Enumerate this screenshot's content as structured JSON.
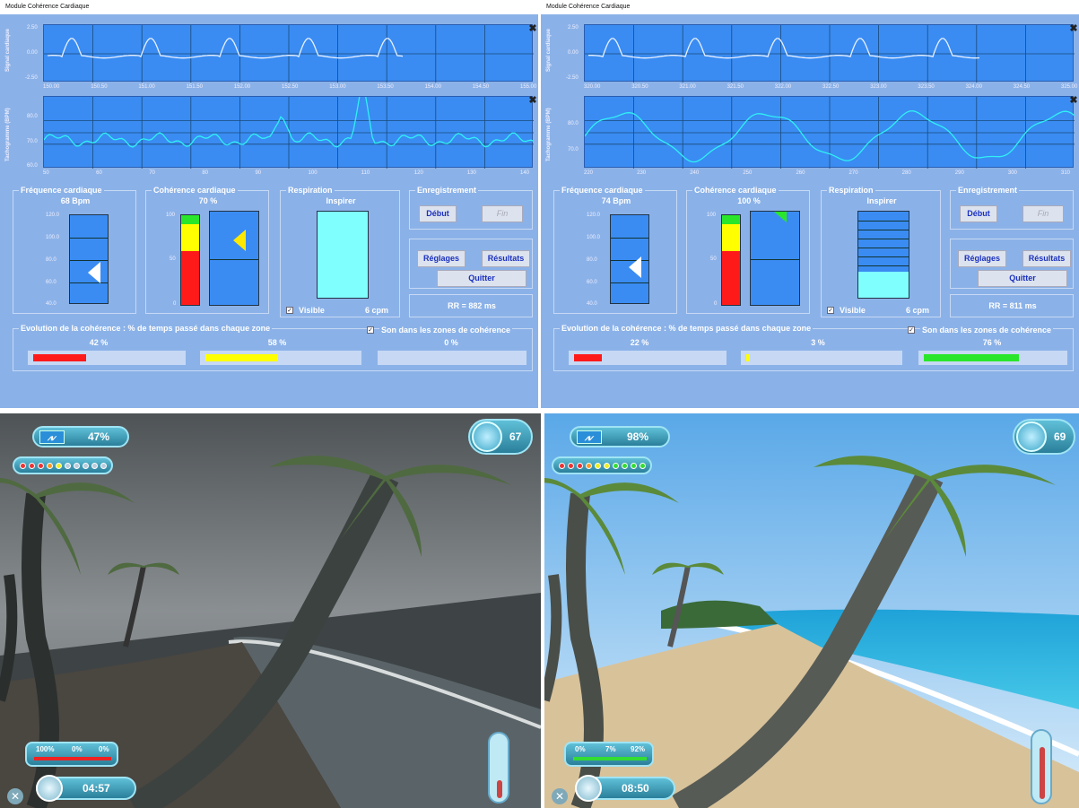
{
  "colors": {
    "app_bg": "#8bb2e8",
    "graph_bg": "#3a8cf2",
    "signal": "#e8f0ff",
    "tacho": "#30f0f4",
    "red": "#ff1a1a",
    "yellow": "#ffff00",
    "green": "#2ae62a",
    "resp": "#80ffff"
  },
  "left": {
    "title": "Module Cohérence Cardiaque",
    "signal": {
      "ylabel": "Signal cardiaque",
      "yticks": [
        "2.50",
        "0.00",
        "-2.50"
      ],
      "xticks": [
        "150.00",
        "150.50",
        "151.00",
        "151.50",
        "152.00",
        "152.50",
        "153.00",
        "153.50",
        "154.00",
        "154.50",
        "155.00"
      ]
    },
    "tacho": {
      "ylabel": "Tachogramme (BPM)",
      "yticks": [
        "80.0",
        "70.0",
        "60.0"
      ],
      "xticks": [
        "50",
        "60",
        "70",
        "80",
        "90",
        "100",
        "110",
        "120",
        "130",
        "140"
      ]
    },
    "freq": {
      "title": "Fréquence cardiaque",
      "value": "68 Bpm",
      "ticks": [
        "120.0",
        "100.0",
        "80.0",
        "60.0",
        "40.0"
      ]
    },
    "coh": {
      "title": "Cohérence cardiaque",
      "value": "70 %",
      "ticks": [
        "100",
        "50",
        "0"
      ]
    },
    "resp": {
      "title": "Respiration",
      "state": "Inspirer",
      "visible": "Visible",
      "rate": "6 cpm",
      "fill": 1.0
    },
    "rec": {
      "title": "Enregistrement",
      "start": "Début",
      "end": "Fin"
    },
    "settings": "Réglages",
    "results": "Résultats",
    "quit": "Quitter",
    "rr": "RR = 882 ms",
    "evo": {
      "title": "Evolution de la cohérence : % de temps passé dans chaque zone",
      "sound": "Son dans les zones de cohérence",
      "red": "42 %",
      "yellow": "58 %",
      "green": "0 %",
      "red_v": 0.42,
      "yellow_v": 0.58,
      "green_v": 0.0
    }
  },
  "right": {
    "title": "Module Cohérence Cardiaque",
    "signal": {
      "ylabel": "Signal cardiaque",
      "yticks": [
        "2.50",
        "0.00",
        "-2.50"
      ],
      "xticks": [
        "320.00",
        "320.50",
        "321.00",
        "321.50",
        "322.00",
        "322.50",
        "323.00",
        "323.50",
        "324.00",
        "324.50",
        "325.00"
      ]
    },
    "tacho": {
      "ylabel": "Tachogramme (BPM)",
      "yticks": [
        "80.0",
        "70.0"
      ],
      "xticks": [
        "220",
        "230",
        "240",
        "250",
        "260",
        "270",
        "280",
        "290",
        "300",
        "310"
      ]
    },
    "freq": {
      "title": "Fréquence cardiaque",
      "value": "74 Bpm",
      "ticks": [
        "120.0",
        "100.0",
        "80.0",
        "60.0",
        "40.0"
      ]
    },
    "coh": {
      "title": "Cohérence cardiaque",
      "value": "100 %",
      "ticks": [
        "100",
        "50",
        "0"
      ]
    },
    "resp": {
      "title": "Respiration",
      "state": "Inspirer",
      "visible": "Visible",
      "rate": "6 cpm",
      "fill": 0.3
    },
    "rec": {
      "title": "Enregistrement",
      "start": "Début",
      "end": "Fin"
    },
    "settings": "Réglages",
    "results": "Résultats",
    "quit": "Quitter",
    "rr": "RR = 811 ms",
    "evo": {
      "title": "Evolution de la cohérence : % de temps passé dans chaque zone",
      "sound": "Son dans les zones de cohérence",
      "red": "22 %",
      "yellow": "3 %",
      "green": "76 %",
      "red_v": 0.22,
      "yellow_v": 0.03,
      "green_v": 0.76
    }
  },
  "game_left": {
    "coherence": "47%",
    "score": "67",
    "zones": [
      "100%",
      "0%",
      "0%"
    ],
    "timer": "04:57"
  },
  "game_right": {
    "coherence": "98%",
    "score": "69",
    "zones": [
      "0%",
      "7%",
      "92%"
    ],
    "timer": "08:50"
  }
}
